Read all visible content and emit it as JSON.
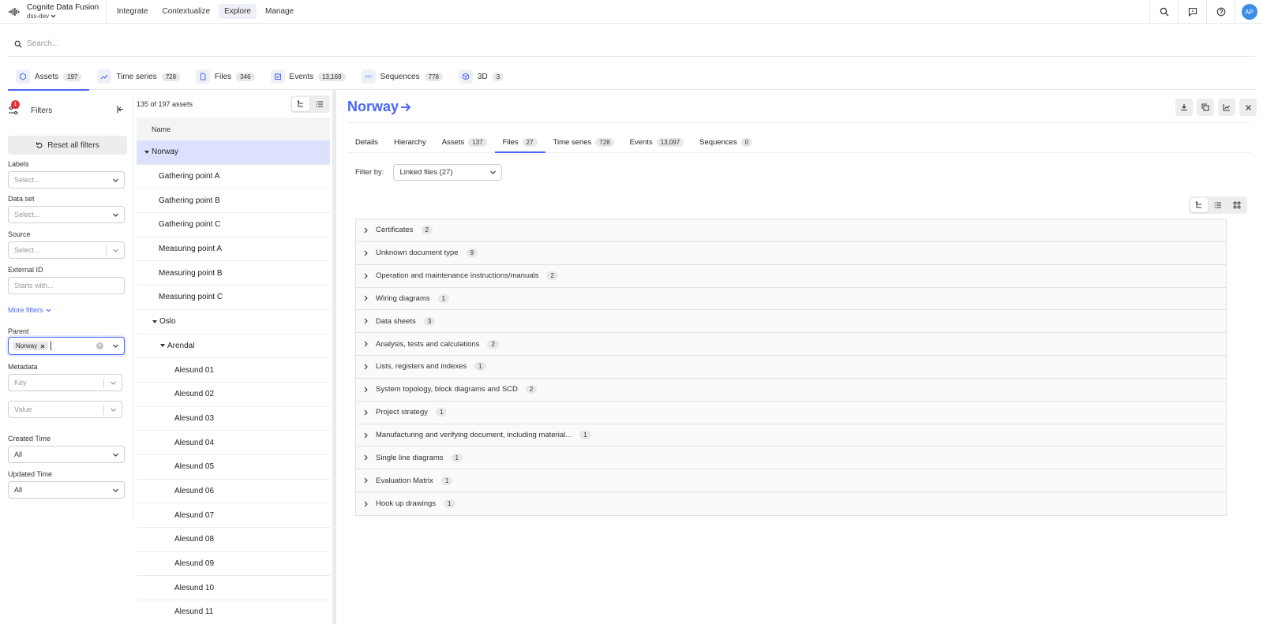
{
  "app": {
    "brand_title": "Cognite Data Fusion",
    "project": "dss-dev",
    "nav": [
      "Integrate",
      "Contextualize",
      "Explore",
      "Manage"
    ],
    "active_nav": "Explore",
    "avatar_initials": "AP"
  },
  "search": {
    "placeholder": "Search..."
  },
  "resource_tabs": [
    {
      "label": "Assets",
      "count": "197",
      "icon": "asset-icon"
    },
    {
      "label": "Time series",
      "count": "728",
      "icon": "timeseries-icon"
    },
    {
      "label": "Files",
      "count": "346",
      "icon": "file-icon"
    },
    {
      "label": "Events",
      "count": "13,169",
      "icon": "events-icon"
    },
    {
      "label": "Sequences",
      "count": "778",
      "icon": "sequences-icon"
    },
    {
      "label": "3D",
      "count": "3",
      "icon": "cube-icon"
    }
  ],
  "filters": {
    "badge": "1",
    "title": "Filters",
    "reset_label": "Reset all filters",
    "labels_label": "Labels",
    "labels_placeholder": "Select...",
    "dataset_label": "Data set",
    "dataset_placeholder": "Select...",
    "source_label": "Source",
    "source_placeholder": "Select...",
    "external_id_label": "External ID",
    "external_id_placeholder": "Starts with...",
    "more_filters": "More filters",
    "parent_label": "Parent",
    "parent_chip": "Norway",
    "metadata_label": "Metadata",
    "key_placeholder": "Key",
    "value_placeholder": "Value",
    "created_label": "Created Time",
    "created_value": "All",
    "updated_label": "Updated Time",
    "updated_value": "All"
  },
  "assets": {
    "count_text": "135 of 197 assets",
    "column": "Name",
    "rows": [
      {
        "name": "Norway",
        "expanded": true
      },
      {
        "name": "Gathering point A"
      },
      {
        "name": "Gathering point B"
      },
      {
        "name": "Gathering point C"
      },
      {
        "name": "Measuring point A"
      },
      {
        "name": "Measuring point B"
      },
      {
        "name": "Measuring point C"
      },
      {
        "name": "Oslo",
        "expanded": true
      },
      {
        "name": "Arendal",
        "expanded": true
      },
      {
        "name": "Alesund 01"
      },
      {
        "name": "Alesund 02"
      },
      {
        "name": "Alesund 03"
      },
      {
        "name": "Alesund 04"
      },
      {
        "name": "Alesund 05"
      },
      {
        "name": "Alesund 06"
      },
      {
        "name": "Alesund 07"
      },
      {
        "name": "Alesund 08"
      },
      {
        "name": "Alesund 09"
      },
      {
        "name": "Alesund 10"
      },
      {
        "name": "Alesund 11"
      }
    ]
  },
  "detail": {
    "title": "Norway",
    "tabs": [
      {
        "label": "Details"
      },
      {
        "label": "Hierarchy"
      },
      {
        "label": "Assets",
        "count": "137"
      },
      {
        "label": "Files",
        "count": "27"
      },
      {
        "label": "Time series",
        "count": "728"
      },
      {
        "label": "Events",
        "count": "13,097"
      },
      {
        "label": "Sequences",
        "count": "0"
      }
    ],
    "active_tab": "Files",
    "filter_by_label": "Filter by:",
    "filter_by_value": "Linked files (27)",
    "categories": [
      {
        "name": "Certificates",
        "count": "2"
      },
      {
        "name": "Unknown document type",
        "count": "9"
      },
      {
        "name": "Operation and maintenance instructions/manuals",
        "count": "2"
      },
      {
        "name": "Wiring diagrams",
        "count": "1"
      },
      {
        "name": "Data sheets",
        "count": "3"
      },
      {
        "name": "Analysis, tests and calculations",
        "count": "2"
      },
      {
        "name": "Lists, registers and indexes",
        "count": "1"
      },
      {
        "name": "System topology, block diagrams and SCD",
        "count": "2"
      },
      {
        "name": "Project strategy",
        "count": "1"
      },
      {
        "name": "Manufacturing and verifying document, including material...",
        "count": "1"
      },
      {
        "name": "Single line diagrams",
        "count": "1"
      },
      {
        "name": "Evaluation Matrix",
        "count": "1"
      },
      {
        "name": "Hook up drawings",
        "count": "1"
      }
    ]
  },
  "colors": {
    "accent": "#4a67fb",
    "selected_row": "#dce2fd",
    "alert": "#e5323b",
    "avatar": "#3a8ee8"
  }
}
